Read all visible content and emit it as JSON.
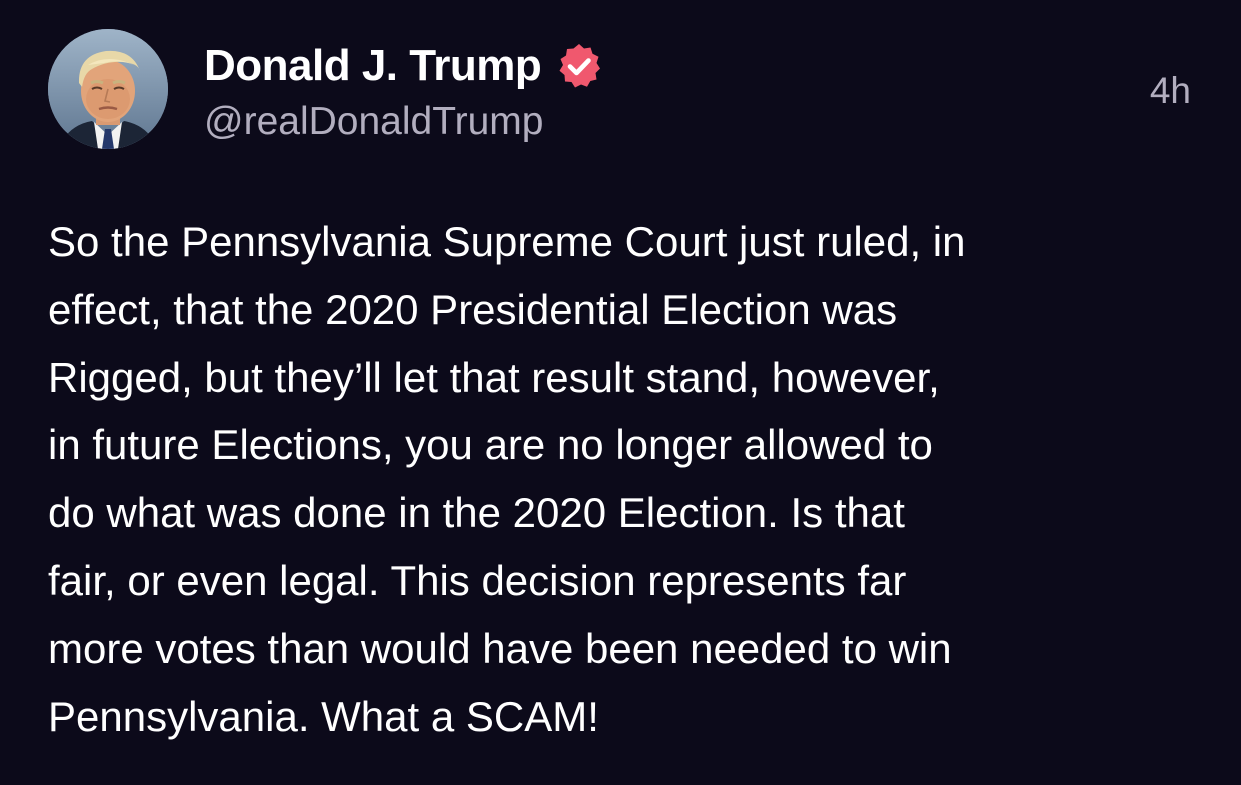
{
  "author": {
    "display_name": "Donald J. Trump",
    "handle": "@realDonaldTrump",
    "verified": true,
    "avatar_icon": "profile-photo",
    "verified_icon": "verified-badge-icon"
  },
  "timestamp": "4h",
  "post": {
    "lines": [
      "So the Pennsylvania Supreme Court just ruled, in",
      "effect, that the 2020 Presidential Election was",
      "Rigged, but they’ll let that result stand, however,",
      "in future Elections, you are no longer allowed to",
      "do what was done in the 2020 Election. Is that",
      "fair, or even legal. This decision represents far",
      "more votes than would have been needed to win",
      "Pennsylvania. What a SCAM!"
    ]
  },
  "colors": {
    "background": "#0c0a1a",
    "text_primary": "#ffffff",
    "text_secondary": "#b2aebf",
    "verified_badge": "#f0586e"
  }
}
